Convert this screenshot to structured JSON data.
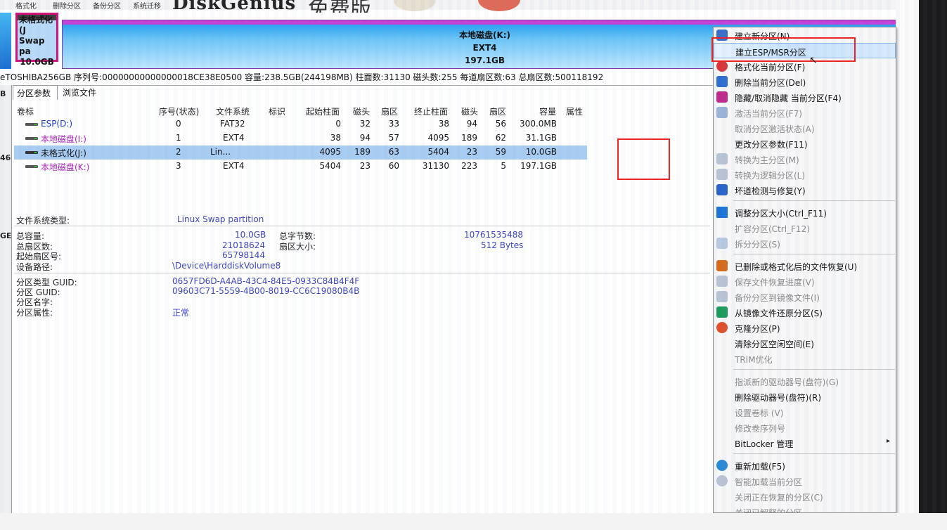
{
  "toolbar": {
    "items": [
      "格式化",
      "删除分区",
      "备份分区",
      "系统迁移"
    ],
    "brand": "DiskGenius",
    "brand_cn": "免费版"
  },
  "disk_map": {
    "part_j": {
      "line1": "未格式化(J",
      "line2": "Swap pa",
      "size": "10.0GB"
    },
    "part_k": {
      "name": "本地磁盘(K:)",
      "fs": "EXT4",
      "size": "197.1GB"
    }
  },
  "disk_info": "eTOSHIBA256GB 序列号:00000000000000018CE38E0500 容量:238.5GB(244198MB) 柱面数:31130 磁头数:255 每道扇区数:63 总扇区数:500118192",
  "left_strip": {
    "label1": "B",
    "label2": "46",
    "label3": "GE"
  },
  "tabs": {
    "params": "分区参数",
    "files": "浏览文件"
  },
  "table": {
    "headers": [
      "卷标",
      "序号(状态)",
      "文件系统",
      "标识",
      "起始柱面",
      "磁头",
      "扇区",
      "终止柱面",
      "磁头",
      "扇区",
      "容量",
      "属性"
    ],
    "rows": [
      {
        "name": "ESP(D:)",
        "idx": "0",
        "fs": "FAT32",
        "start_cyl": "0",
        "start_head": "32",
        "start_sec": "33",
        "end_cyl": "38",
        "end_head": "94",
        "end_sec": "56",
        "cap": "300.0MB"
      },
      {
        "name": "本地磁盘(I:)",
        "idx": "1",
        "fs": "EXT4",
        "start_cyl": "38",
        "start_head": "94",
        "start_sec": "57",
        "end_cyl": "4095",
        "end_head": "189",
        "end_sec": "62",
        "cap": "31.1GB"
      },
      {
        "name": "未格式化(J:)",
        "idx": "2",
        "fs": "Lin...",
        "start_cyl": "4095",
        "start_head": "189",
        "start_sec": "63",
        "end_cyl": "5404",
        "end_head": "23",
        "end_sec": "59",
        "cap": "10.0GB"
      },
      {
        "name": "本地磁盘(K:)",
        "idx": "3",
        "fs": "EXT4",
        "start_cyl": "5404",
        "start_head": "23",
        "start_sec": "60",
        "end_cyl": "31130",
        "end_head": "223",
        "end_sec": "5",
        "cap": "197.1GB"
      }
    ]
  },
  "details": {
    "fs_type_label": "文件系统类型:",
    "fs_type_value": "Linux Swap partition",
    "total_cap_label": "总容量:",
    "total_cap_value": "10.0GB",
    "total_bytes_label": "总字节数:",
    "total_bytes_value": "10761535488",
    "total_sectors_label": "总扇区数:",
    "total_sectors_value": "21018624",
    "sector_size_label": "扇区大小:",
    "sector_size_value": "512 Bytes",
    "start_sector_label": "起始扇区号:",
    "start_sector_value": "65798144",
    "device_path_label": "设备路径:",
    "device_path_value": "\\Device\\HarddiskVolume8",
    "type_guid_label": "分区类型 GUID:",
    "type_guid_value": "0657FD6D-A4AB-43C4-84E5-0933C84B4F4F",
    "part_guid_label": "分区 GUID:",
    "part_guid_value": "09603C71-5559-4B00-8019-CC6C19080B4B",
    "part_name_label": "分区名字:",
    "part_attr_label": "分区属性:",
    "part_attr_value": "正常"
  },
  "context_menu": {
    "items": [
      {
        "label": "建立新分区(N)",
        "enabled": true,
        "icon": "new-partition-icon",
        "color": "#3a6fc8"
      },
      {
        "label": "建立ESP/MSR分区",
        "enabled": true,
        "icon": "",
        "highlighted": true
      },
      {
        "label": "格式化当前分区(F)",
        "enabled": true,
        "icon": "format-icon",
        "color": "#d8363a"
      },
      {
        "label": "删除当前分区(Del)",
        "enabled": true,
        "icon": "delete-icon",
        "color": "#2e6fd0"
      },
      {
        "label": "隐藏/取消隐藏 当前分区(F4)",
        "enabled": true,
        "icon": "hide-icon",
        "color": "#c02a8a"
      },
      {
        "label": "激活当前分区(F7)",
        "enabled": false,
        "icon": "activate-icon",
        "color": "#9cb4d8"
      },
      {
        "label": "取消分区激活状态(A)",
        "enabled": false,
        "icon": "",
        "color": ""
      },
      {
        "label": "更改分区参数(F11)",
        "enabled": true,
        "icon": "",
        "color": ""
      },
      {
        "label": "转换为主分区(M)",
        "enabled": false,
        "icon": "convert-primary-icon",
        "color": "#b8c4d4"
      },
      {
        "label": "转换为逻辑分区(L)",
        "enabled": false,
        "icon": "convert-logical-icon",
        "color": "#b8c4d4"
      },
      {
        "label": "坏道检测与修复(Y)",
        "enabled": true,
        "icon": "repair-icon",
        "color": "#2a62c8"
      },
      {
        "label": "调整分区大小(Ctrl_F11)",
        "enabled": true,
        "icon": "resize-icon",
        "color": "#1e74d6"
      },
      {
        "label": "扩容分区(Ctrl_F12)",
        "enabled": false,
        "icon": "",
        "color": ""
      },
      {
        "label": "拆分分区(S)",
        "enabled": false,
        "icon": "split-icon",
        "color": "#b8c8e0"
      },
      {
        "label": "已删除或格式化后的文件恢复(U)",
        "enabled": true,
        "icon": "recover-icon",
        "color": "#d66a1c"
      },
      {
        "label": "保存文件恢复进度(V)",
        "enabled": false,
        "icon": "save-progress-icon",
        "color": "#b8c4d4"
      },
      {
        "label": "备份分区到镜像文件(I)",
        "enabled": false,
        "icon": "backup-icon",
        "color": "#b8c4d4"
      },
      {
        "label": "从镜像文件还原分区(S)",
        "enabled": true,
        "icon": "restore-icon",
        "color": "#1e9a5a"
      },
      {
        "label": "克隆分区(P)",
        "enabled": true,
        "icon": "clone-icon",
        "color": "#e0502a"
      },
      {
        "label": "清除分区空闲空间(E)",
        "enabled": true,
        "icon": "",
        "color": ""
      },
      {
        "label": "TRIM优化",
        "enabled": false,
        "icon": "",
        "color": ""
      },
      {
        "label": "指派新的驱动器号(盘符)(G)",
        "enabled": false,
        "icon": "",
        "color": ""
      },
      {
        "label": "删除驱动器号(盘符)(R)",
        "enabled": true,
        "icon": "",
        "color": ""
      },
      {
        "label": "设置卷标 (V)",
        "enabled": false,
        "icon": "",
        "color": ""
      },
      {
        "label": "修改卷序列号",
        "enabled": false,
        "icon": "",
        "color": ""
      },
      {
        "label": "BitLocker 管理",
        "enabled": true,
        "icon": "",
        "color": "",
        "submenu": true
      },
      {
        "label": "重新加载(F5)",
        "enabled": true,
        "icon": "reload-icon",
        "color": "#2a8ad6"
      },
      {
        "label": "智能加载当前分区",
        "enabled": false,
        "icon": "smart-load-icon",
        "color": "#b8c4d4"
      },
      {
        "label": "关闭正在恢复的分区(C)",
        "enabled": false,
        "icon": "",
        "color": ""
      },
      {
        "label": "关闭已解释的分区",
        "enabled": false,
        "icon": "",
        "color": ""
      }
    ],
    "submenu_arrow": "▸"
  },
  "cursor_glyph": "↖"
}
